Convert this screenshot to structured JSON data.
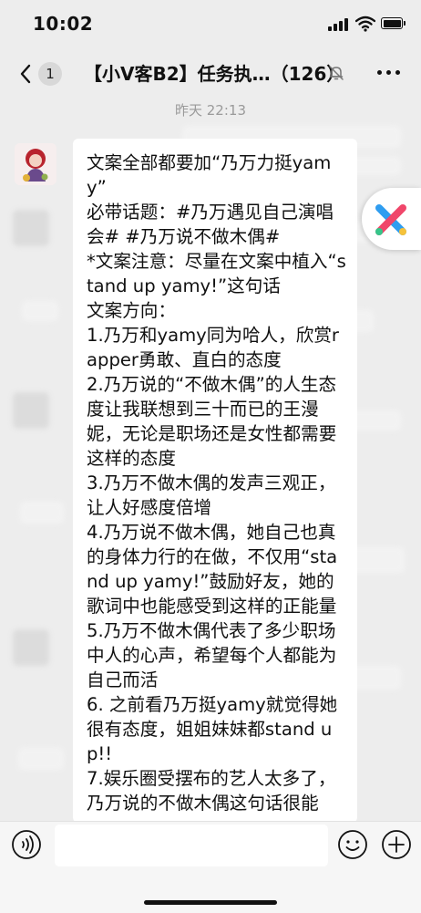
{
  "status_bar": {
    "time": "10:02"
  },
  "nav": {
    "unread_count": "1",
    "title": "【小V客B2】任务执…（126）",
    "icons": [
      "back-arrow-icon",
      "mute-bell-icon",
      "more-icon"
    ]
  },
  "timestamp": "昨天 22:13",
  "message": {
    "text": "文案全部都要加“乃万力挺yamy”\n必带话题：#乃万遇见自己演唱会# #乃万说不做木偶#\n*文案注意：尽量在文案中植入“stand up yamy!”这句话\n文案方向：\n1.乃万和yamy同为哈人，欣赏rapper勇敢、直白的态度\n2.乃万说的“不做木偶”的人生态度让我联想到三十而已的王漫妮，无论是职场还是女性都需要这样的态度\n3.乃万不做木偶的发声三观正，让人好感度倍增\n4.乃万说不做木偶，她自己也真的身体力行的在做，不仅用“stand up yamy!”鼓励好友，她的歌词中也能感受到这样的正能量\n5.乃万不做木偶代表了多少职场中人的心声，希望每个人都能为自己而活\n6. 之前看乃万挺yamy就觉得她很有态度，姐姐妹妹都stand up!!\n7.娱乐圈受摆布的艺人太多了，乃万说的不做木偶这句话很能"
  },
  "input_bar": {
    "icons": [
      "voice-icon",
      "emoji-icon",
      "plus-icon"
    ]
  },
  "colors": {
    "background": "#ededed",
    "bubble": "#ffffff",
    "timestamp": "#9a9a9a",
    "text": "#111111"
  }
}
